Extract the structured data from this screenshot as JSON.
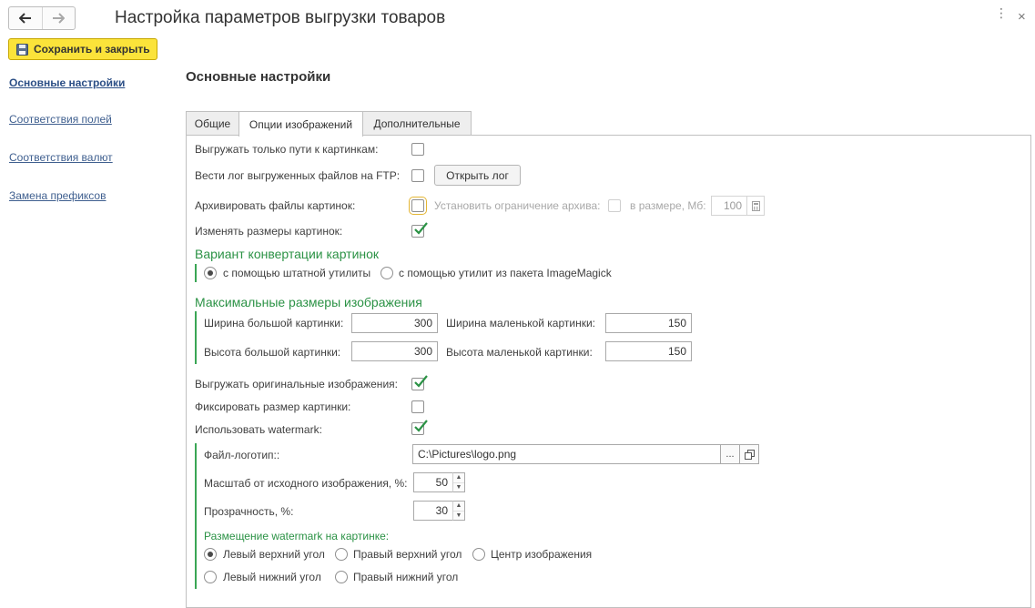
{
  "window": {
    "title": "Настройка параметров выгрузки товаров",
    "close_glyph": "×",
    "more_glyph": "⋮",
    "nav_back_icon": "arrow-left-icon",
    "nav_forward_icon": "arrow-right-icon"
  },
  "toolbar": {
    "save_close_label": "Сохранить и закрыть",
    "save_icon": "floppy-disk-icon",
    "accent_color": "#fbe33a"
  },
  "sidebar": {
    "items": [
      {
        "label": "Основные настройки",
        "active": true
      },
      {
        "label": "Соответствия полей",
        "active": false
      },
      {
        "label": "Соответствия валют",
        "active": false
      },
      {
        "label": "Замена префиксов",
        "active": false
      }
    ]
  },
  "main": {
    "section_title": "Основные настройки",
    "tabs": [
      {
        "label": "Общие",
        "active": false
      },
      {
        "label": "Опции изображений",
        "active": true
      },
      {
        "label": "Дополнительные",
        "active": false
      }
    ]
  },
  "image_options": {
    "export_paths_only": {
      "label": "Выгружать только пути к картинкам:",
      "checked": false
    },
    "ftp_log": {
      "label": "Вести лог выгруженных файлов на FTP:",
      "checked": false,
      "button_label": "Открыть лог"
    },
    "archive_images": {
      "label": "Архивировать файлы картинок:",
      "checked": false
    },
    "archive_limit": {
      "label": "Установить ограничение архива:",
      "checked": false,
      "enabled": false
    },
    "archive_size": {
      "label": "в размере, Мб:",
      "value": "100",
      "calc_icon": "calculator-icon"
    },
    "resize_images": {
      "label": "Изменять размеры картинок:",
      "checked": true
    },
    "conversion": {
      "title": "Вариант конвертации картинок",
      "options": [
        {
          "label": "с помощью штатной утилиты",
          "selected": true
        },
        {
          "label": "с помощью утилит из пакета ImageMagick",
          "selected": false
        }
      ]
    },
    "max_sizes": {
      "title": "Максимальные размеры изображения",
      "large_width": {
        "label": "Ширина большой картинки:",
        "value": "300"
      },
      "large_height": {
        "label": "Высота большой картинки:",
        "value": "300"
      },
      "small_width": {
        "label": "Ширина маленькой картинки:",
        "value": "150"
      },
      "small_height": {
        "label": "Высота маленькой картинки:",
        "value": "150"
      }
    },
    "export_originals": {
      "label": "Выгружать оригинальные изображения:",
      "checked": true
    },
    "fix_size": {
      "label": "Фиксировать размер картинки:",
      "checked": false
    },
    "use_watermark": {
      "label": "Использовать watermark:",
      "checked": true
    },
    "watermark": {
      "logo_file": {
        "label": "Файл-логотип::",
        "value": "C:\\Pictures\\logo.png",
        "browse_glyph": "...",
        "open_icon": "open-window-icon"
      },
      "scale": {
        "label": "Масштаб от исходного изображения, %:",
        "value": "50"
      },
      "opacity": {
        "label": "Прозрачность, %:",
        "value": "30"
      },
      "placement": {
        "title": "Размещение watermark на картинке:",
        "options": [
          {
            "label": "Левый верхний угол",
            "selected": true
          },
          {
            "label": "Правый верхний угол",
            "selected": false
          },
          {
            "label": "Центр изображения",
            "selected": false
          },
          {
            "label": "Левый нижний угол",
            "selected": false
          },
          {
            "label": "Правый нижний угол",
            "selected": false
          }
        ]
      }
    },
    "green_color": "#2b9245",
    "spin_up": "▲",
    "spin_down": "▼"
  }
}
